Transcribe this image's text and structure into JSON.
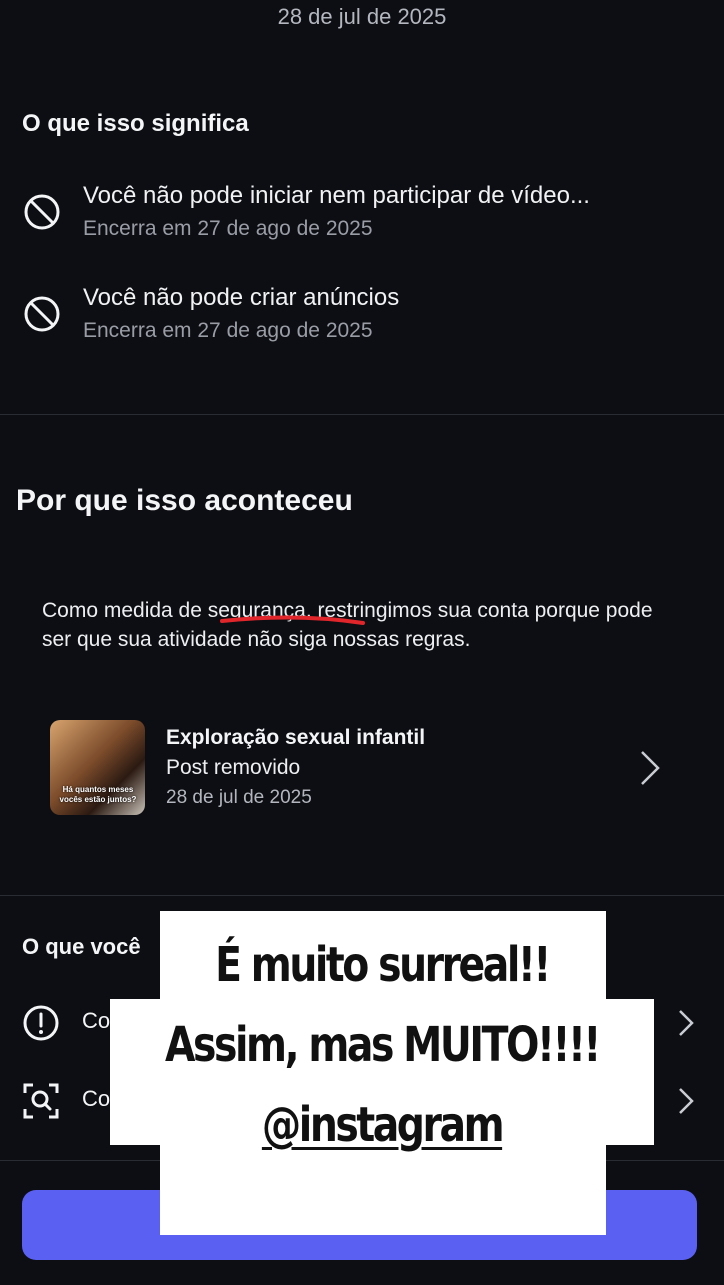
{
  "header": {
    "date": "28 de jul de 2025"
  },
  "meaning": {
    "title": "O que isso significa",
    "items": [
      {
        "icon": "block-icon",
        "title": "Você não pode iniciar nem participar de vídeo...",
        "subtitle": "Encerra em 27 de ago de 2025"
      },
      {
        "icon": "block-icon",
        "title": "Você não pode criar anúncios",
        "subtitle": "Encerra em 27 de ago de 2025"
      }
    ]
  },
  "reason": {
    "title": "Por que isso aconteceu",
    "paragraph": "Como medida de segurança, restringimos sua conta porque pode ser que sua atividade não siga nossas regras.",
    "post": {
      "thumbnail_caption": "Há quantos meses vocês estão juntos?",
      "title": "Exploração sexual infantil",
      "status": "Post removido",
      "date": "28 de jul de 2025"
    }
  },
  "actions": {
    "title": "O que você",
    "rows": [
      {
        "icon": "alert-circle-icon",
        "label": "Co"
      },
      {
        "icon": "scan-search-icon",
        "label": "Co"
      }
    ]
  },
  "sticker": {
    "line1": "É muito surreal!!",
    "line2": "Assim, mas MUITO!!!!",
    "line3": "@instagram"
  },
  "colors": {
    "background": "#0d0e13",
    "primary_button": "#5a60f2",
    "annotation_red": "#e0262b"
  }
}
